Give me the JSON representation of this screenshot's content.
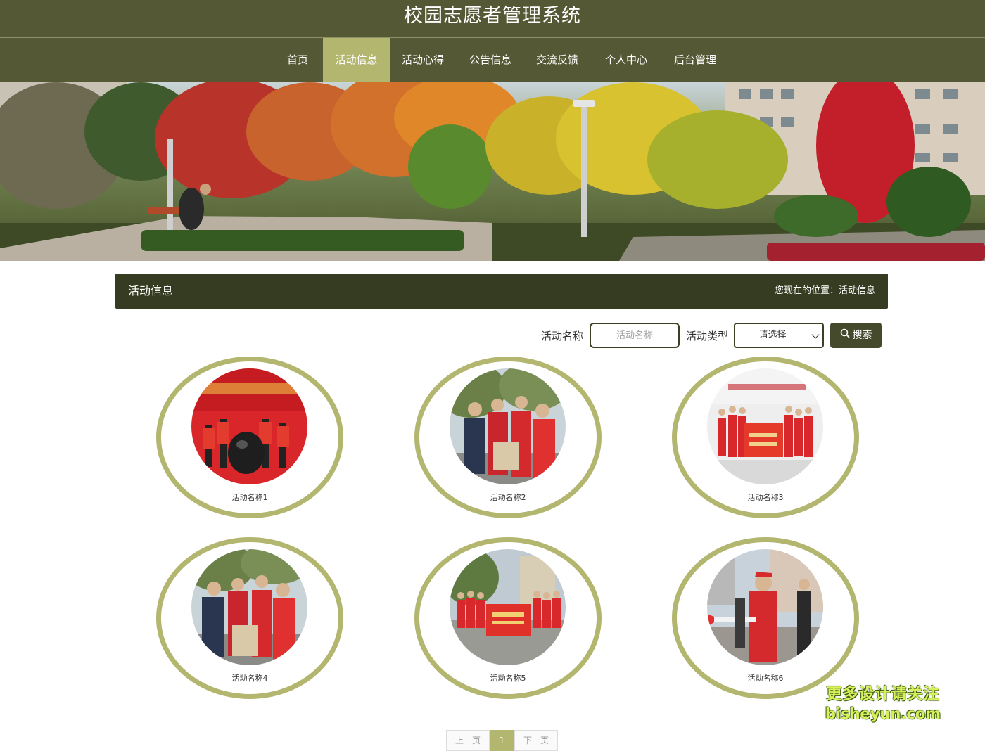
{
  "site": {
    "title": "校园志愿者管理系统"
  },
  "nav": {
    "items": [
      {
        "label": "首页",
        "active": false
      },
      {
        "label": "活动信息",
        "active": true
      },
      {
        "label": "活动心得",
        "active": false
      },
      {
        "label": "公告信息",
        "active": false
      },
      {
        "label": "交流反馈",
        "active": false
      },
      {
        "label": "个人中心",
        "active": false
      },
      {
        "label": "后台管理",
        "active": false
      }
    ]
  },
  "section": {
    "title": "活动信息",
    "breadcrumb": "您现在的位置：活动信息"
  },
  "search": {
    "name_label": "活动名称",
    "name_placeholder": "活动名称",
    "name_value": "",
    "type_label": "活动类型",
    "type_selected": "请选择",
    "button_label": "搜索"
  },
  "activities": [
    {
      "name": "活动名称1"
    },
    {
      "name": "活动名称2"
    },
    {
      "name": "活动名称3"
    },
    {
      "name": "活动名称4"
    },
    {
      "name": "活动名称5"
    },
    {
      "name": "活动名称6"
    }
  ],
  "pagination": {
    "prev": "上一页",
    "current": "1",
    "next": "下一页"
  },
  "watermark": {
    "line1": "更多设计请关注",
    "line2": "bisheyun.com"
  },
  "colors": {
    "header": "#545834",
    "accent": "#b3b66f",
    "section_bar": "#363c21"
  }
}
